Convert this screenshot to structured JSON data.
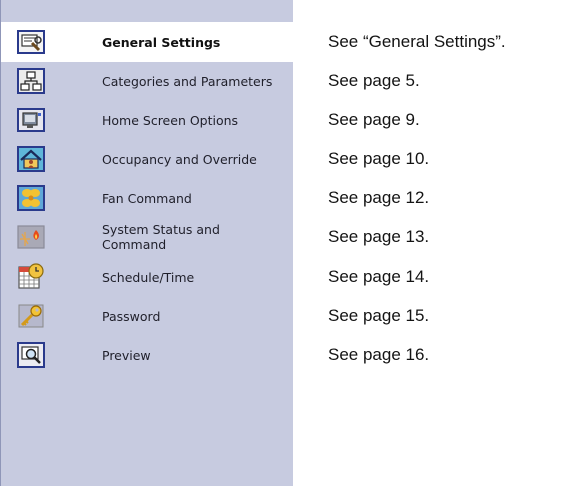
{
  "sidebar": {
    "items": [
      {
        "label": "General Settings",
        "icon": "general-settings-icon",
        "selected": true
      },
      {
        "label": "Categories and Parameters",
        "icon": "categories-icon"
      },
      {
        "label": "Home Screen Options",
        "icon": "home-screen-icon"
      },
      {
        "label": "Occupancy and Override",
        "icon": "occupancy-icon"
      },
      {
        "label": "Fan Command",
        "icon": "fan-icon"
      },
      {
        "label": "System Status and Command",
        "icon": "system-status-icon"
      },
      {
        "label": "Schedule/Time",
        "icon": "schedule-icon"
      },
      {
        "label": "Password",
        "icon": "password-key-icon"
      },
      {
        "label": "Preview",
        "icon": "preview-icon"
      }
    ]
  },
  "references": [
    "See “General Settings”.",
    "See page 5.",
    "See page 9.",
    "See page 10.",
    "See page 12.",
    "See page 13.",
    "See page 14.",
    "See page 15.",
    "See page 16."
  ],
  "colors": {
    "sidebar_bg": "#c7cbe0",
    "selected_bg": "#ffffff",
    "icon_frame": "#2a3a8c"
  }
}
